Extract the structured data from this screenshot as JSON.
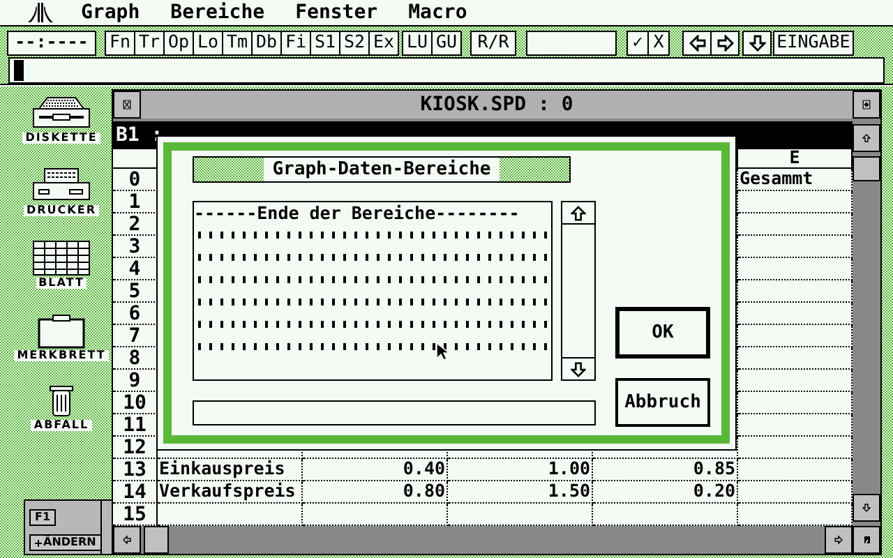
{
  "menu_bar": {
    "items": [
      "Graph",
      "Bereiche",
      "Fenster",
      "Macro"
    ]
  },
  "toolbar": {
    "time_display": "--:----",
    "function_buttons": [
      "Fn",
      "Tr",
      "Op",
      "Lo",
      "Tm",
      "Db",
      "Fi",
      "S1",
      "S2",
      "Ex"
    ],
    "range_buttons": [
      "LU",
      "GU"
    ],
    "mode_button": "R/R",
    "confirm_buttons": [
      "✓",
      "X"
    ],
    "input_button": "EINGABE"
  },
  "desktop_icons": [
    {
      "label": "DISKETTE",
      "kind": "disk"
    },
    {
      "label": "DRUCKER",
      "kind": "printer"
    },
    {
      "label": "BLATT",
      "kind": "sheet"
    },
    {
      "label": "MERKBRETT",
      "kind": "clipboard"
    },
    {
      "label": "ABFALL",
      "kind": "trash"
    }
  ],
  "function_key_panel": {
    "key": "F1",
    "action": "ÄNDERN"
  },
  "window": {
    "title": "KIOSK.SPD : 0",
    "cell_line": "B1 :",
    "column_e_header": "E",
    "rows": [
      {
        "number": "0",
        "cells": {
          "column_e": "Gesammt"
        }
      },
      {
        "number": "1",
        "cells": {}
      },
      {
        "number": "2",
        "cells": {}
      },
      {
        "number": "3",
        "cells": {}
      },
      {
        "number": "4",
        "cells": {}
      },
      {
        "number": "5",
        "cells": {}
      },
      {
        "number": "6",
        "cells": {}
      },
      {
        "number": "7",
        "cells": {}
      },
      {
        "number": "8",
        "cells": {}
      },
      {
        "number": "9",
        "cells": {}
      },
      {
        "number": "10",
        "cells": {}
      },
      {
        "number": "11",
        "cells": {}
      },
      {
        "number": "12",
        "cells": {}
      },
      {
        "number": "13",
        "cells": {
          "column_1": "Einkauspreis",
          "column_2": "0.40",
          "column_3": "1.00",
          "column_4": "0.85"
        }
      },
      {
        "number": "14",
        "cells": {
          "column_1": "Verkaufspreis",
          "column_2": "0.80",
          "column_3": "1.50",
          "column_4": "0.20"
        }
      },
      {
        "number": "15",
        "cells": {}
      }
    ]
  },
  "dialog": {
    "title": "Graph-Daten-Bereiche",
    "list_header": "------Ende der Bereiche--------",
    "buttons": [
      {
        "label": "OK",
        "default": true
      },
      {
        "label": "Abbruch",
        "default": false
      }
    ]
  }
}
